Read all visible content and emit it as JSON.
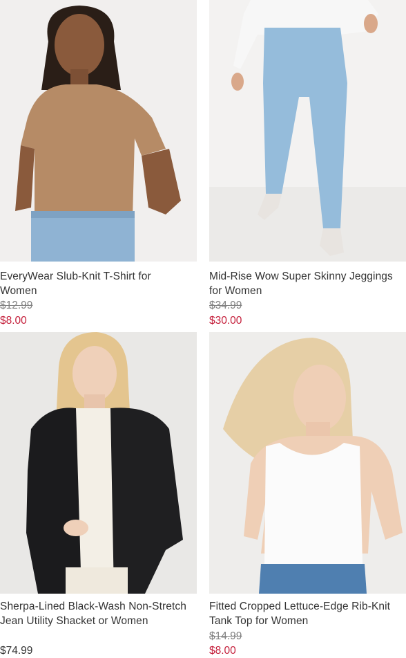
{
  "colors": {
    "sale_price": "#c41e3a",
    "regular_price": "#333333",
    "strikethrough_price": "#808080"
  },
  "products": [
    {
      "title": "EveryWear Slub-Knit T-Shirt for Women",
      "original_price": "$12.99",
      "sale_price": "$8.00",
      "sale_highlighted": true
    },
    {
      "title": "Mid-Rise Wow Super Skinny Jeggings for Women",
      "original_price": "$34.99",
      "sale_price": "$30.00",
      "sale_highlighted": true
    },
    {
      "title": "Sherpa-Lined Black-Wash Non-Stretch Jean Utility Shacket or Women",
      "original_price": "",
      "sale_price": "$74.99",
      "sale_highlighted": false
    },
    {
      "title": "Fitted Cropped Lettuce-Edge Rib-Knit Tank Top for Women",
      "original_price": "$14.99",
      "sale_price": "$8.00",
      "sale_highlighted": true
    }
  ]
}
